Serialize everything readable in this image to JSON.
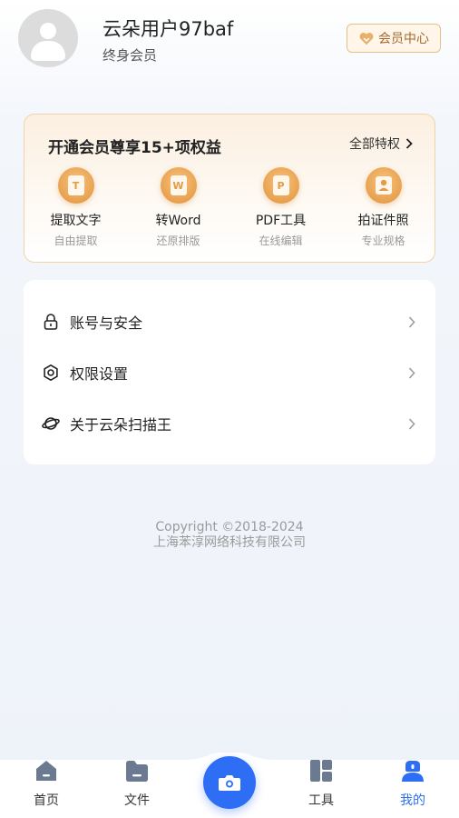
{
  "profile": {
    "username": "云朵用户97baf",
    "member_type": "终身会员",
    "vip_center_label": "会员中心"
  },
  "vip_card": {
    "title": "开通会员尊享15+项权益",
    "all_privileges_label": "全部特权",
    "perks": [
      {
        "name": "提取文字",
        "sub": "自由提取",
        "icon": "text-extract-icon",
        "glyph": "T"
      },
      {
        "name": "转Word",
        "sub": "还原排版",
        "icon": "word-icon",
        "glyph": "W"
      },
      {
        "name": "PDF工具",
        "sub": "在线编辑",
        "icon": "pdf-icon",
        "glyph": "P"
      },
      {
        "name": "拍证件照",
        "sub": "专业规格",
        "icon": "id-photo-icon",
        "glyph": ""
      }
    ]
  },
  "settings": {
    "items": [
      {
        "label": "账号与安全",
        "icon": "lock-icon"
      },
      {
        "label": "权限设置",
        "icon": "gear-icon"
      },
      {
        "label": "关于云朵扫描王",
        "icon": "planet-icon"
      }
    ]
  },
  "copyright": {
    "line1": "Copyright ©2018-2024",
    "line2": "上海苯淳网络科技有限公司"
  },
  "tabbar": {
    "tabs": [
      {
        "label": "首页",
        "icon": "home-icon"
      },
      {
        "label": "文件",
        "icon": "folder-icon"
      },
      {
        "label": "工具",
        "icon": "tools-grid-icon"
      },
      {
        "label": "我的",
        "icon": "profile-icon",
        "active": true
      }
    ],
    "camera_icon": "camera-icon"
  },
  "colors": {
    "accent": "#2e6ef5",
    "gold": "#e8a14f",
    "gold_border": "#f0d4a8",
    "tab_icon": "#6b7a90"
  }
}
